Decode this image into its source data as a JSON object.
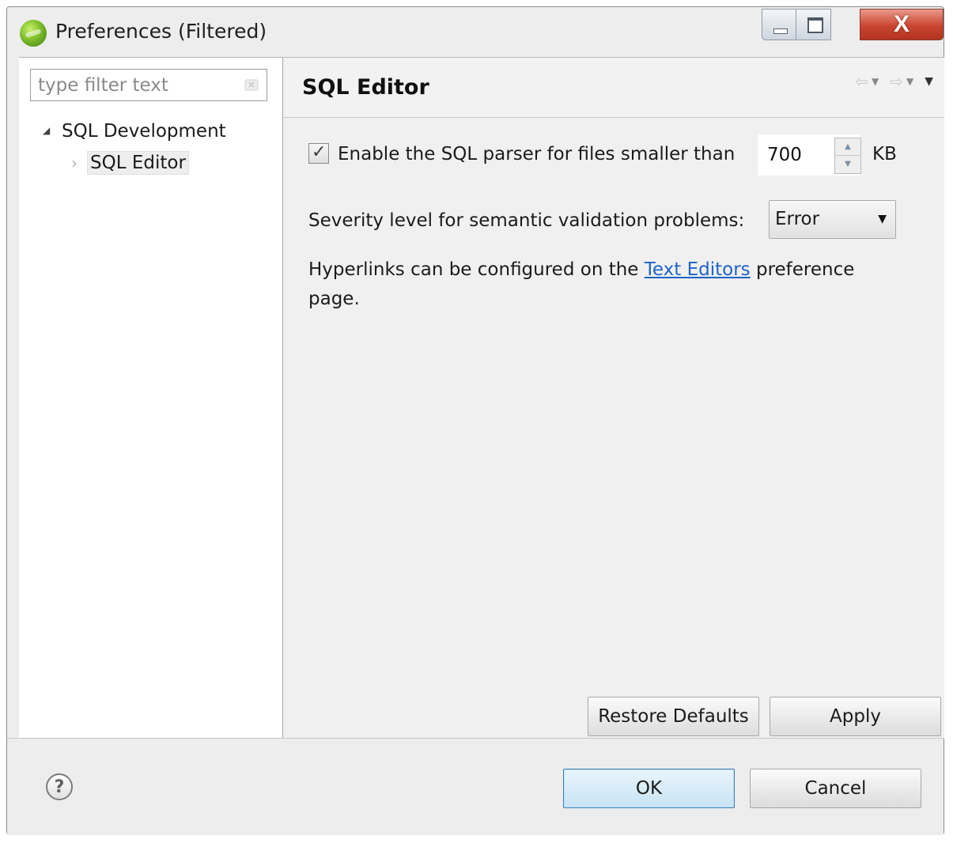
{
  "window": {
    "title": "Preferences (Filtered)",
    "controls": {
      "minimize": "minimize",
      "maximize": "maximize",
      "close": "X"
    }
  },
  "sidebar": {
    "filter_placeholder": "type filter text",
    "tree": [
      {
        "label": "SQL Development",
        "expanded": true
      },
      {
        "label": "SQL Editor",
        "selected": true
      }
    ]
  },
  "page": {
    "title": "SQL Editor",
    "nav_icons": [
      "back-arrow-icon",
      "forward-arrow-icon",
      "view-menu-icon"
    ],
    "parser": {
      "checked": true,
      "label": "Enable the SQL parser for files smaller than",
      "value": "700",
      "unit": "KB"
    },
    "severity": {
      "label": "Severity level for semantic validation problems:",
      "value": "Error"
    },
    "hyperlinks": {
      "before": "Hyperlinks can be configured on the ",
      "link": "Text Editors",
      "after": " preference page."
    },
    "restore_defaults": "Restore Defaults",
    "apply": "Apply"
  },
  "footer": {
    "help_icon": "?",
    "ok": "OK",
    "cancel": "Cancel"
  },
  "colors": {
    "link": "#1e64c8",
    "close_button": "#c9452f",
    "ok_border": "#3c7fb1"
  }
}
